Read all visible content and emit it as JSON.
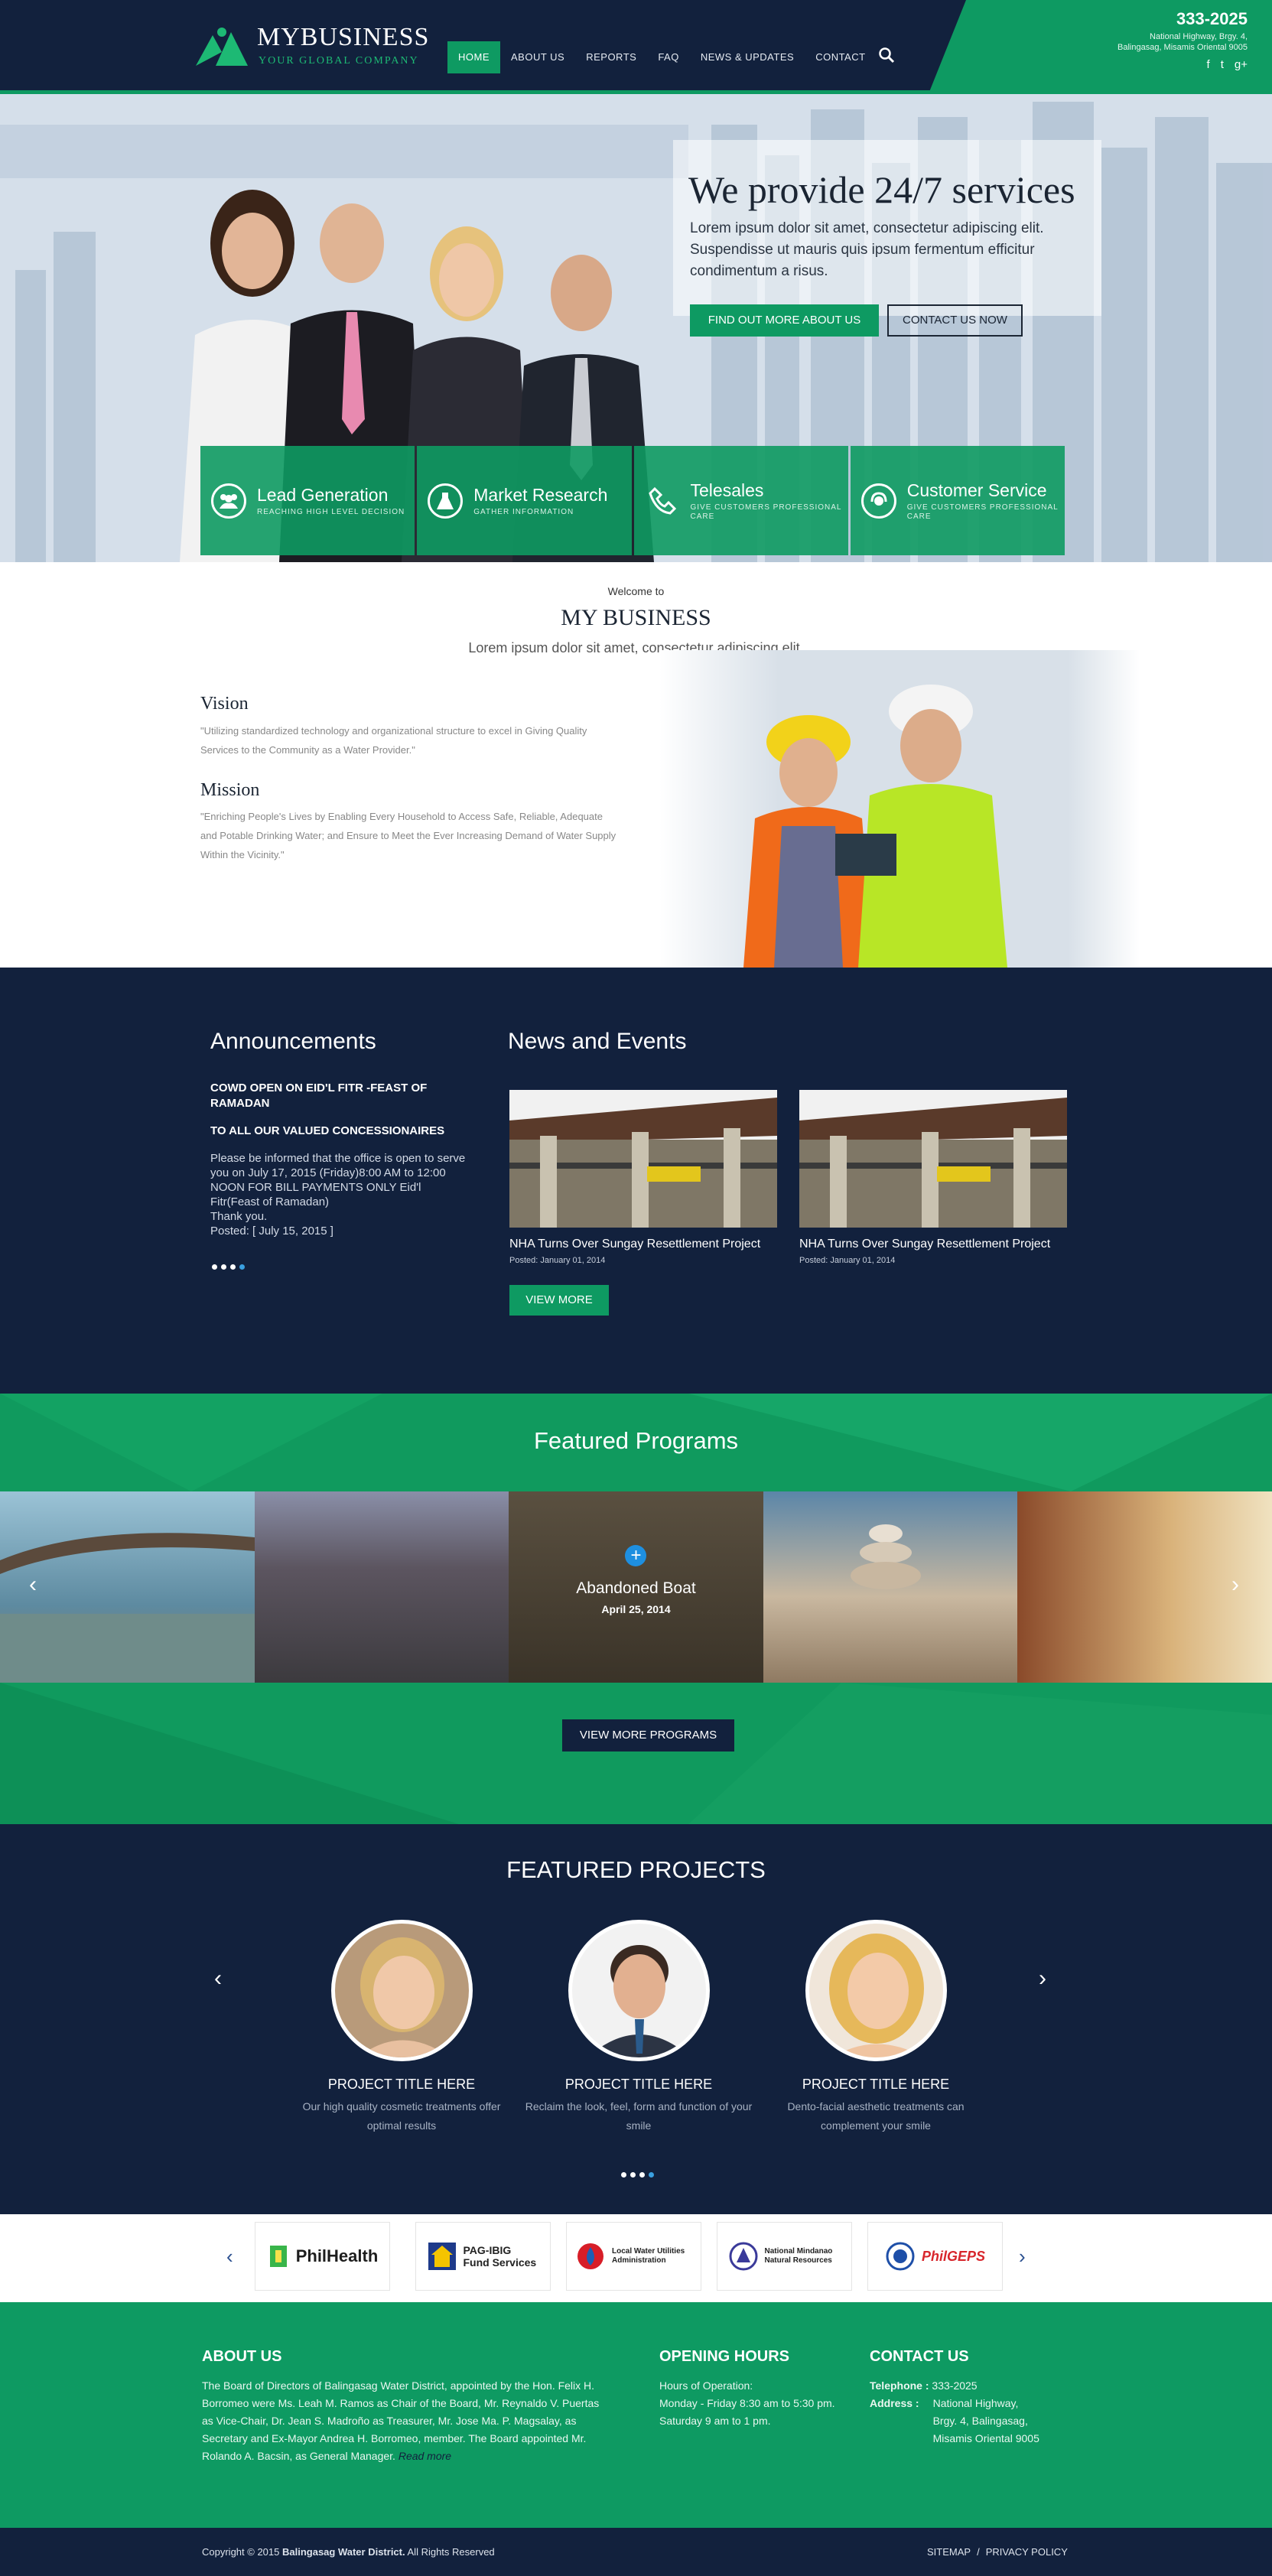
{
  "header": {
    "logo_name": "MYBUSINESS",
    "logo_tagline": "YOUR GLOBAL COMPANY",
    "nav": [
      "HOME",
      "ABOUT US",
      "REPORTS",
      "FAQ",
      "NEWS & UPDATES",
      "CONTACT"
    ],
    "phone": "333-2025",
    "address_line1": "National Highway, Brgy. 4,",
    "address_line2": "Balingasag, Misamis Oriental 9005",
    "social": [
      "f",
      "t",
      "g+"
    ]
  },
  "hero": {
    "title": "We provide 24/7 services",
    "text": "Lorem ipsum dolor sit amet, consectetur adipiscing elit. Suspendisse ut mauris quis ipsum fermentum efficitur condimentum a risus.",
    "btn_primary": "FIND OUT MORE ABOUT US",
    "btn_secondary": "CONTACT US NOW"
  },
  "services": [
    {
      "title": "Lead Generation",
      "sub": "REACHING HIGH LEVEL DECISION",
      "icon": "people-icon"
    },
    {
      "title": "Market Research",
      "sub": "GATHER INFORMATION",
      "icon": "flask-icon"
    },
    {
      "title": "Telesales",
      "sub": "GIVE CUSTOMERS PROFESSIONAL CARE",
      "icon": "phone-icon"
    },
    {
      "title": "Customer Service",
      "sub": "GIVE CUSTOMERS PROFESSIONAL CARE",
      "icon": "headset-icon"
    }
  ],
  "welcome": {
    "small": "Welcome to",
    "title": "MY BUSINESS",
    "lead": "Lorem ipsum dolor sit amet, consectetur adipiscing elit.",
    "vision_title": "Vision",
    "vision_text": "\"Utilizing standardized technology and organizational structure to excel in Giving Quality Services to the Community as a Water Provider.\"",
    "mission_title": "Mission",
    "mission_text": "\"Enriching People's Lives by Enabling Every Household to Access Safe, Reliable, Adequate and Potable Drinking Water; and Ensure to Meet the Ever Increasing Demand of Water Supply Within the Vicinity.\""
  },
  "announcements": {
    "title": "Announcements",
    "item1": "COWD OPEN ON EID'L FITR -FEAST OF RAMADAN",
    "item2": "TO ALL OUR VALUED CONCESSIONAIRES",
    "body1": "Please be informed that the office is open to serve you on July 17, 2015 (Friday)8:00 AM to 12:00 NOON FOR BILL PAYMENTS ONLY Eid'l Fitr(Feast of Ramadan)",
    "body2": "Thank you.",
    "body3": "Posted: [ July 15, 2015 ]"
  },
  "news": {
    "title": "News and Events",
    "items": [
      {
        "title": "NHA Turns Over Sungay Resettlement Project",
        "date": "Posted: January 01, 2014"
      },
      {
        "title": "NHA Turns Over Sungay Resettlement Project",
        "date": "Posted: January 01, 2014"
      }
    ],
    "view_more": "VIEW MORE"
  },
  "programs": {
    "title": "Featured Programs",
    "caption": "Abandoned Boat",
    "date": "April 25, 2014",
    "button": "VIEW MORE PROGRAMS"
  },
  "projects": {
    "title": "FEATURED PROJECTS",
    "items": [
      {
        "name": "PROJECT TITLE HERE",
        "desc": "Our high quality cosmetic treatments offer optimal results"
      },
      {
        "name": "PROJECT TITLE HERE",
        "desc": "Reclaim the look, feel, form and function of your smile"
      },
      {
        "name": "PROJECT TITLE HERE",
        "desc": "Dento-facial aesthetic treatments can complement your smile"
      }
    ]
  },
  "partners": [
    {
      "name": "PhilHealth"
    },
    {
      "name": "PAG-IBIG Fund Services"
    },
    {
      "name": "Local Water Utilities Administration"
    },
    {
      "name": "National Mindanao Natural Resources"
    },
    {
      "name": "PhilGEPS"
    }
  ],
  "footer": {
    "about_title": "ABOUT US",
    "about_text": "The Board of Directors of Balingasag Water District, appointed by the Hon. Felix H. Borromeo were Ms. Leah M. Ramos as Chair of the Board, Mr. Reynaldo V. Puertas as Vice-Chair, Dr. Jean S. Madroño as Treasurer, Mr. Jose Ma. P. Magsalay, as Secretary and Ex-Mayor Andrea H. Borromeo, member.  The Board appointed Mr. Rolando A. Bacsin, as General Manager.",
    "read_more": "Read more",
    "hours_title": "OPENING HOURS",
    "hours1": "Hours of Operation:",
    "hours2": "Monday - Friday 8:30 am to 5:30 pm.",
    "hours3": "Saturday 9 am to 1 pm.",
    "contact_title": "CONTACT US",
    "tel_label": "Telephone  :",
    "tel_value": "333-2025",
    "addr_label": "Address    :",
    "addr1": "National Highway,",
    "addr2": "Brgy. 4, Balingasag,",
    "addr3": "Misamis Oriental 9005",
    "copyright_prefix": "Copyright © 2015 ",
    "copyright_company": "Balingasag Water District.",
    "copyright_suffix": " All Rights Reserved",
    "links": [
      "SITEMAP",
      "PRIVACY POLICY"
    ],
    "link_sep": "/"
  },
  "colors": {
    "navy": "#12213d",
    "green": "#0e9a62",
    "accent_blue": "#1e8fe0"
  }
}
